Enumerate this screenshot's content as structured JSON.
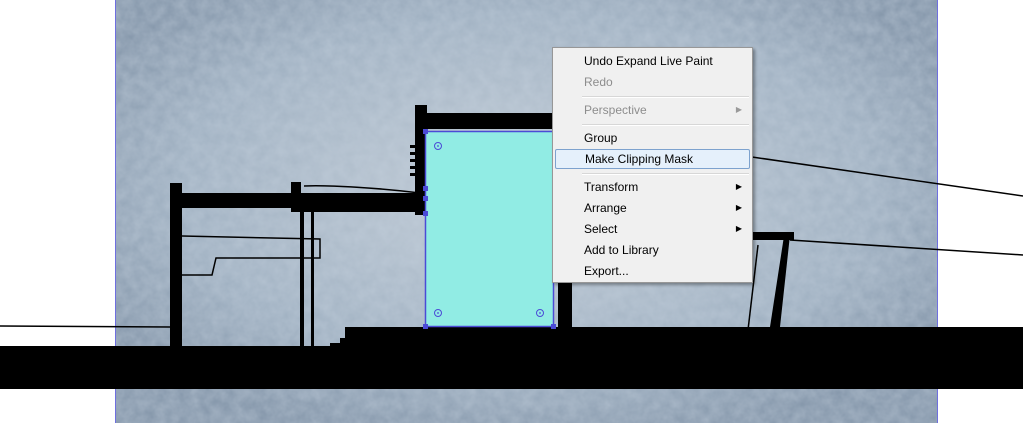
{
  "context_menu": {
    "items": [
      {
        "label": "Undo Expand Live Paint",
        "enabled": true,
        "submenu": false
      },
      {
        "label": "Redo",
        "enabled": false,
        "submenu": false
      },
      {
        "label": "Perspective",
        "enabled": false,
        "submenu": true
      },
      {
        "label": "Group",
        "enabled": true,
        "submenu": false
      },
      {
        "label": "Make Clipping Mask",
        "enabled": true,
        "submenu": false,
        "highlighted": true
      },
      {
        "label": "Transform",
        "enabled": true,
        "submenu": true
      },
      {
        "label": "Arrange",
        "enabled": true,
        "submenu": true
      },
      {
        "label": "Select",
        "enabled": true,
        "submenu": true
      },
      {
        "label": "Add to Library",
        "enabled": true,
        "submenu": false
      },
      {
        "label": "Export...",
        "enabled": true,
        "submenu": false
      }
    ],
    "submenu_arrow": "▶"
  },
  "colors": {
    "texture_base": "#9aacbf",
    "selected_fill": "#91ece4",
    "selection_stroke": "#4b4bd6",
    "artboard_border": "#6f6fe0",
    "silhouette": "#000000"
  }
}
